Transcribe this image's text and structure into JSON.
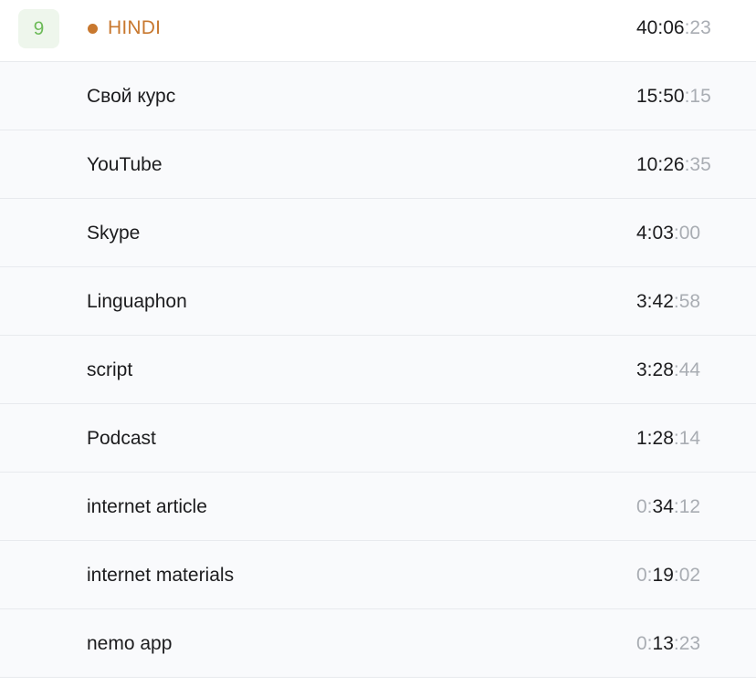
{
  "header": {
    "rank": "9",
    "language": "HINDI",
    "time": {
      "lead": "",
      "main": "40:06",
      "sec": ":23"
    }
  },
  "rows": [
    {
      "label": "Свой курс",
      "time": {
        "lead": "",
        "main": "15:50",
        "sec": ":15"
      }
    },
    {
      "label": "YouTube",
      "time": {
        "lead": "",
        "main": "10:26",
        "sec": ":35"
      }
    },
    {
      "label": "Skype",
      "time": {
        "lead": "",
        "main": "4:03",
        "sec": ":00"
      }
    },
    {
      "label": "Linguaphon",
      "time": {
        "lead": "",
        "main": "3:42",
        "sec": ":58"
      }
    },
    {
      "label": "script",
      "time": {
        "lead": "",
        "main": "3:28",
        "sec": ":44"
      }
    },
    {
      "label": "Podcast",
      "time": {
        "lead": "",
        "main": "1:28",
        "sec": ":14"
      }
    },
    {
      "label": "internet article",
      "time": {
        "lead": "0:",
        "main": "34",
        "sec": ":12"
      }
    },
    {
      "label": "internet materials",
      "time": {
        "lead": "0:",
        "main": "19",
        "sec": ":02"
      }
    },
    {
      "label": "nemo app",
      "time": {
        "lead": "0:",
        "main": "13",
        "sec": ":23"
      }
    }
  ],
  "colors": {
    "accent": "#c8782f",
    "badge_text": "#6dbb59",
    "badge_bg": "#eef6ec",
    "muted": "#a9adb3"
  }
}
